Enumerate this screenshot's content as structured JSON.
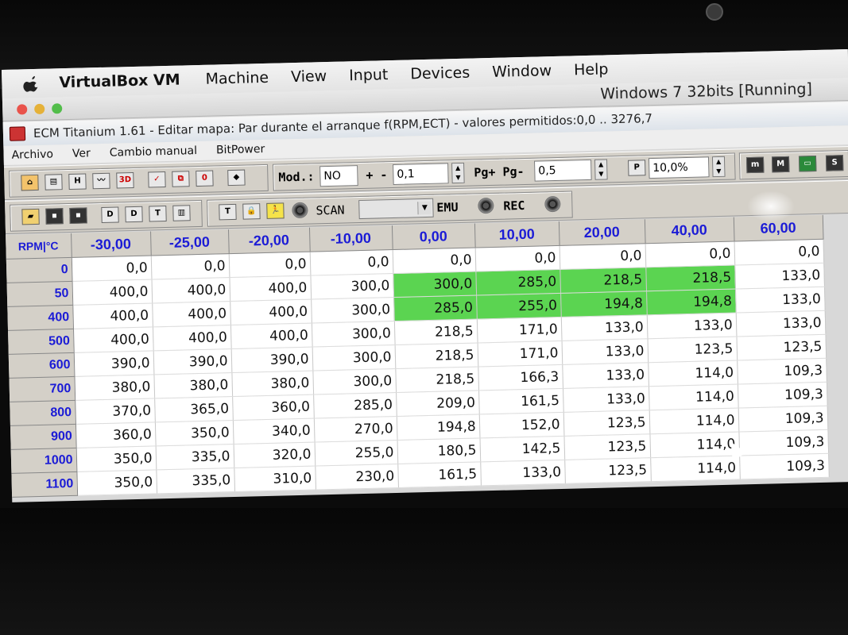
{
  "mac_menubar": {
    "app_name": "VirtualBox VM",
    "items": [
      "Machine",
      "View",
      "Input",
      "Devices",
      "Window",
      "Help"
    ]
  },
  "vm_status": "Windows 7 32bits [Running]",
  "window_title": "ECM Titanium 1.61 - Editar mapa: Par durante el arranque f(RPM,ECT) - valores permitidos:0,0 .. 3276,7",
  "app_menu": [
    "Archivo",
    "Ver",
    "Cambio manual",
    "BitPower"
  ],
  "toolbar1": {
    "mod_label": "Mod.:",
    "mod_value": "NO",
    "plusminus_label": "+ -",
    "plusminus_value": "0,1",
    "page_label": "Pg+ Pg-",
    "page_value": "0,5",
    "percent_value": "10,0%",
    "icons": [
      "home-icon",
      "windows-icon",
      "hex-icon",
      "graph-icon",
      "3d-icon",
      "check-icon",
      "compare-icon",
      "zero-icon",
      "shapes-icon"
    ],
    "right_icons": [
      "m-icon",
      "M-icon",
      "color-icon",
      "S-icon"
    ]
  },
  "toolbar2": {
    "scan_label": "SCAN",
    "scan_value": "",
    "emu_label": "EMU",
    "rec_label": "REC"
  },
  "table": {
    "corner": "RPM|°C",
    "columns": [
      "-30,00",
      "-25,00",
      "-20,00",
      "-10,00",
      "0,00",
      "10,00",
      "20,00",
      "40,00",
      "60,00"
    ],
    "rows": [
      {
        "rpm": "0",
        "values": [
          "0,0",
          "0,0",
          "0,0",
          "0,0",
          "0,0",
          "0,0",
          "0,0",
          "0,0",
          "0,0"
        ]
      },
      {
        "rpm": "50",
        "values": [
          "400,0",
          "400,0",
          "400,0",
          "300,0",
          "300,0",
          "285,0",
          "218,5",
          "218,5",
          "133,0"
        ]
      },
      {
        "rpm": "400",
        "values": [
          "400,0",
          "400,0",
          "400,0",
          "300,0",
          "285,0",
          "255,0",
          "194,8",
          "194,8",
          "133,0"
        ]
      },
      {
        "rpm": "500",
        "values": [
          "400,0",
          "400,0",
          "400,0",
          "300,0",
          "218,5",
          "171,0",
          "133,0",
          "133,0",
          "133,0"
        ]
      },
      {
        "rpm": "600",
        "values": [
          "390,0",
          "390,0",
          "390,0",
          "300,0",
          "218,5",
          "171,0",
          "133,0",
          "123,5",
          "123,5"
        ]
      },
      {
        "rpm": "700",
        "values": [
          "380,0",
          "380,0",
          "380,0",
          "300,0",
          "218,5",
          "166,3",
          "133,0",
          "114,0",
          "109,3"
        ]
      },
      {
        "rpm": "800",
        "values": [
          "370,0",
          "365,0",
          "360,0",
          "285,0",
          "209,0",
          "161,5",
          "133,0",
          "114,0",
          "109,3"
        ]
      },
      {
        "rpm": "900",
        "values": [
          "360,0",
          "350,0",
          "340,0",
          "270,0",
          "194,8",
          "152,0",
          "123,5",
          "114,0",
          "109,3"
        ]
      },
      {
        "rpm": "1000",
        "values": [
          "350,0",
          "335,0",
          "320,0",
          "255,0",
          "180,5",
          "142,5",
          "123,5",
          "114,0",
          "109,3"
        ]
      },
      {
        "rpm": "1100",
        "values": [
          "350,0",
          "335,0",
          "310,0",
          "230,0",
          "161,5",
          "133,0",
          "123,5",
          "114,0",
          "109,3"
        ]
      }
    ],
    "selected_cells": [
      [
        1,
        4
      ],
      [
        1,
        5
      ],
      [
        1,
        6
      ],
      [
        1,
        7
      ],
      [
        2,
        4
      ],
      [
        2,
        5
      ],
      [
        2,
        6
      ],
      [
        2,
        7
      ]
    ],
    "selection_color": "#5bd451",
    "header_color": "#1b1bd6"
  }
}
